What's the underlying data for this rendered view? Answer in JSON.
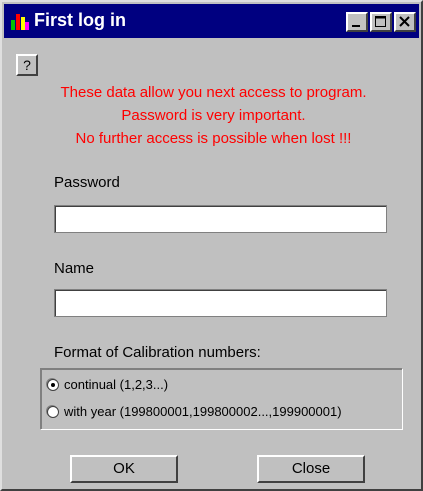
{
  "window": {
    "title": "First log in",
    "help_label": "?"
  },
  "warning": {
    "line1": "These data allow you next access to program.",
    "line2": "Password is very important.",
    "line3": "No further access is possible when lost !!!",
    "color": "#ff0000"
  },
  "password": {
    "label": "Password",
    "value": "",
    "placeholder": ""
  },
  "name": {
    "label": "Name",
    "value": "",
    "placeholder": ""
  },
  "calibration": {
    "label": "Format of Calibration numbers:",
    "options": [
      {
        "label": "continual (1,2,3...)",
        "selected": true
      },
      {
        "label": "with year (199800001,199800002...,199900001)",
        "selected": false
      }
    ]
  },
  "buttons": {
    "ok_label": "OK",
    "close_label": "Close"
  },
  "colors": {
    "titlebar": "#000080",
    "face": "#c0c0c0"
  },
  "icons": [
    "app-logo-icon",
    "minimize-icon",
    "maximize-icon",
    "close-icon"
  ]
}
